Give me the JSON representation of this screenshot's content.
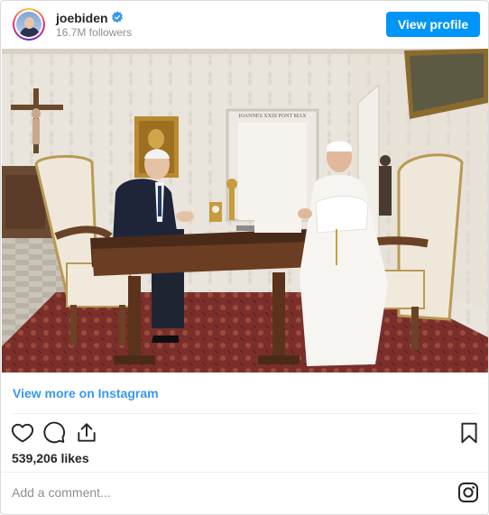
{
  "header": {
    "username": "joebiden",
    "followers": "16.7M followers",
    "view_profile_label": "View profile"
  },
  "post": {
    "photo_alt": "photo",
    "plaque_text": "IOANNES XXIII PONT MAX"
  },
  "view_more_label": "View more on Instagram",
  "likes": "539,206 likes",
  "comment_placeholder": "Add a comment...",
  "icons": {
    "verified": "verified-badge-icon",
    "like": "heart-icon",
    "comment": "comment-icon",
    "share": "share-icon",
    "save": "bookmark-icon",
    "instagram": "instagram-icon"
  },
  "colors": {
    "accent": "#0095f6",
    "link": "#3897f0",
    "muted": "#8e8e8e"
  }
}
